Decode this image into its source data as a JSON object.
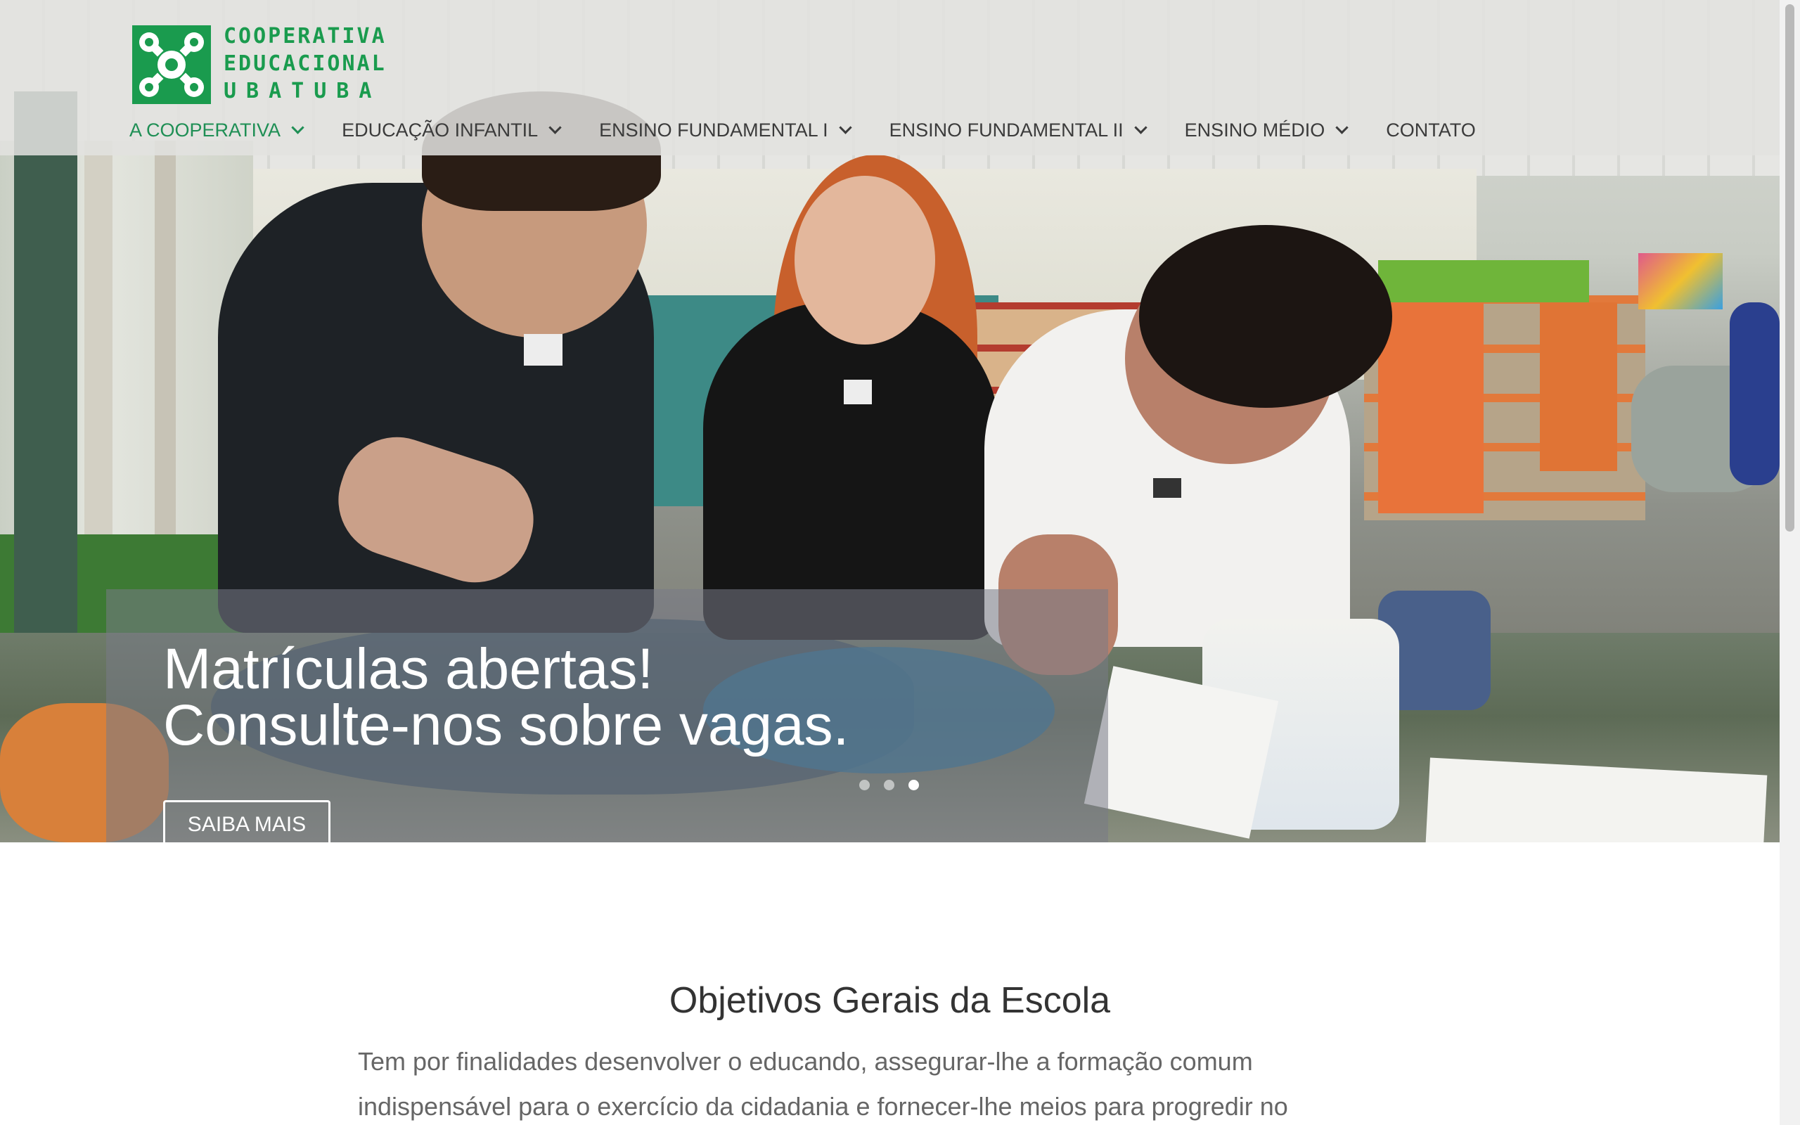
{
  "logo": {
    "text_lines": [
      "COOPERATIVA",
      "EDUCACIONAL",
      "UBATUBA"
    ],
    "brand_color": "#1a9b4e"
  },
  "nav": {
    "items": [
      {
        "label": "A COOPERATIVA",
        "has_dropdown": true,
        "active": true
      },
      {
        "label": "EDUCAÇÃO INFANTIL",
        "has_dropdown": true,
        "active": false
      },
      {
        "label": "ENSINO FUNDAMENTAL I",
        "has_dropdown": true,
        "active": false
      },
      {
        "label": "ENSINO FUNDAMENTAL II",
        "has_dropdown": true,
        "active": false
      },
      {
        "label": "ENSINO MÉDIO",
        "has_dropdown": true,
        "active": false
      },
      {
        "label": "CONTATO",
        "has_dropdown": false,
        "active": false
      }
    ],
    "active_color": "#1f8f55"
  },
  "slider": {
    "title_line1": "Matrículas abertas!",
    "title_line2": "Consulte-nos sobre vagas.",
    "button_label": "SAIBA MAIS",
    "slide_count": 3,
    "active_slide": 3
  },
  "content": {
    "section_title": "Objetivos Gerais da Escola",
    "paragraph": "Tem por finalidades desenvolver o educando, assegurar-lhe a formação comum indispensável para o exercício da cidadania e fornecer-lhe meios para progredir no"
  }
}
